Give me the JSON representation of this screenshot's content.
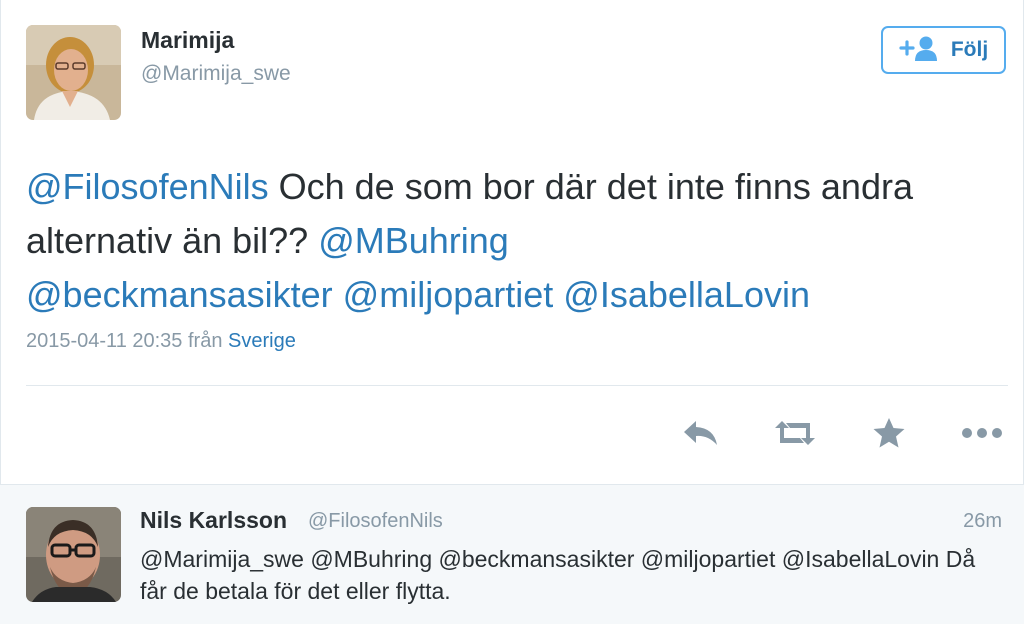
{
  "main_tweet": {
    "name": "Marimija",
    "handle": "@Marimija_swe",
    "follow_label": "Följ",
    "text": {
      "mention1": "@FilosofenNils",
      "body1": " Och de som bor där det inte finns andra alternativ än bil?? ",
      "mention2": "@MBuhring",
      "mention3": "@beckmansasikter",
      "mention4": "@miljopartiet",
      "mention5": "@IsabellaLovin"
    },
    "timestamp": "2015-04-11 20:35 från",
    "place": "Sverige",
    "actions": {
      "reply_icon": "reply-icon",
      "retweet_icon": "retweet-icon",
      "favorite_icon": "star-icon",
      "more_icon": "more-icon"
    }
  },
  "reply": {
    "name": "Nils Karlsson",
    "handle": "@FilosofenNils",
    "time": "26m",
    "text": "@Marimija_swe @MBuhring @beckmansasikter @miljopartiet @IsabellaLovin Då får de betala för det eller flytta."
  },
  "colors": {
    "link": "#2b7bb9",
    "muted": "#8899a6",
    "text": "#292f33",
    "follow_border": "#55acee",
    "action_icon": "#8899a6"
  }
}
